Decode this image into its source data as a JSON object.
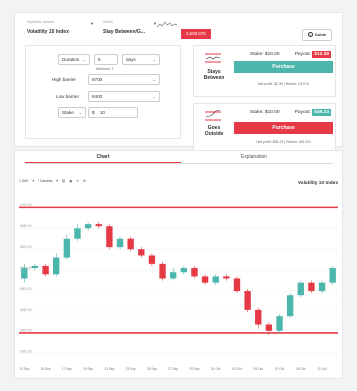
{
  "header": {
    "market_label": "Synthetic Indices",
    "market_value": "Volatility 10 Index",
    "type_label": "Out/In",
    "type_value": "Stay Between/G...",
    "price": "6,593.075",
    "guide_label": "Guide"
  },
  "params": {
    "duration_label": "Duration",
    "duration_value": "5",
    "duration_unit": "days",
    "duration_hint": "Minimum: 1",
    "high_label": "High barrier",
    "high_value": "6700",
    "low_label": "Low barrier",
    "low_value": "6400",
    "stake_label": "Stake",
    "currency": "$",
    "stake_value": "10"
  },
  "contracts": [
    {
      "name": "Stays Between",
      "stake": "Stake: $10.00",
      "payout_label": "Payout:",
      "payout_value": "$12.39",
      "button": "Purchase",
      "net": "Net profit: $2.39 | Return: 23.9 %",
      "accent": "#e63946",
      "button_color": "#4db6ac"
    },
    {
      "name": "Goes Outside",
      "stake": "Stake: $10.00",
      "payout_label": "Payout:",
      "payout_value": "$46.23",
      "button": "Purchase",
      "net": "Net profit: $36.23 | Return: 362.3%",
      "accent": "#4db6ac",
      "button_color": "#e63946"
    }
  ],
  "tabs": {
    "chart": "Chart",
    "explanation": "Explanation"
  },
  "toolbar": {
    "interval": "1 DAY",
    "style": "Candles",
    "icons": [
      "bar-chart-icon",
      "eye-icon",
      "pencil-icon",
      "settings-icon"
    ]
  },
  "chart_title": "Volatility 10 Index",
  "chart_data": {
    "type": "candlestick",
    "y_ticks": [
      "6700.00",
      "6650.00",
      "6600.00",
      "6550.00",
      "6500.00",
      "6450.00",
      "6400.00",
      "6350.00"
    ],
    "x_ticks": [
      "13 Sep",
      "14 Sep",
      "15 Sep",
      "16 Sep",
      "17 Sep",
      "18 Sep",
      "19 Sep",
      "20 Sep",
      "21 Sep",
      "22 Sep",
      "23 Sep",
      "24 Sep",
      "25 Sep",
      "26 Sep",
      "27 Sep",
      "28 Sep",
      "29 Sep",
      "30 Sep",
      "01 Oct",
      "02 Oct",
      "03 Oct",
      "04 Oct",
      "05 Oct",
      "06 Oct",
      "07 Oct",
      "08 Oct",
      "09 Oct",
      "10 Oct",
      "11 Oct",
      "12 Oct"
    ],
    "ylim": [
      6340,
      6720
    ],
    "barriers": [
      6700,
      6400
    ],
    "candles": [
      {
        "o": 6530,
        "c": 6555,
        "h": 6565,
        "l": 6520
      },
      {
        "o": 6555,
        "c": 6560,
        "h": 6565,
        "l": 6550
      },
      {
        "o": 6560,
        "c": 6540,
        "h": 6565,
        "l": 6535
      },
      {
        "o": 6540,
        "c": 6580,
        "h": 6590,
        "l": 6535
      },
      {
        "o": 6580,
        "c": 6625,
        "h": 6635,
        "l": 6575
      },
      {
        "o": 6625,
        "c": 6650,
        "h": 6660,
        "l": 6620
      },
      {
        "o": 6650,
        "c": 6660,
        "h": 6665,
        "l": 6645
      },
      {
        "o": 6660,
        "c": 6655,
        "h": 6665,
        "l": 6650
      },
      {
        "o": 6655,
        "c": 6605,
        "h": 6660,
        "l": 6600
      },
      {
        "o": 6605,
        "c": 6625,
        "h": 6630,
        "l": 6600
      },
      {
        "o": 6625,
        "c": 6600,
        "h": 6630,
        "l": 6595
      },
      {
        "o": 6600,
        "c": 6585,
        "h": 6605,
        "l": 6580
      },
      {
        "o": 6585,
        "c": 6565,
        "h": 6590,
        "l": 6560
      },
      {
        "o": 6565,
        "c": 6530,
        "h": 6570,
        "l": 6525
      },
      {
        "o": 6530,
        "c": 6545,
        "h": 6555,
        "l": 6525
      },
      {
        "o": 6545,
        "c": 6555,
        "h": 6560,
        "l": 6540
      },
      {
        "o": 6555,
        "c": 6535,
        "h": 6560,
        "l": 6530
      },
      {
        "o": 6535,
        "c": 6520,
        "h": 6540,
        "l": 6515
      },
      {
        "o": 6520,
        "c": 6535,
        "h": 6540,
        "l": 6515
      },
      {
        "o": 6535,
        "c": 6530,
        "h": 6540,
        "l": 6525
      },
      {
        "o": 6530,
        "c": 6500,
        "h": 6535,
        "l": 6495
      },
      {
        "o": 6500,
        "c": 6455,
        "h": 6505,
        "l": 6450
      },
      {
        "o": 6455,
        "c": 6420,
        "h": 6460,
        "l": 6410
      },
      {
        "o": 6420,
        "c": 6405,
        "h": 6425,
        "l": 6395
      },
      {
        "o": 6405,
        "c": 6440,
        "h": 6445,
        "l": 6398
      },
      {
        "o": 6440,
        "c": 6490,
        "h": 6495,
        "l": 6435
      },
      {
        "o": 6490,
        "c": 6520,
        "h": 6525,
        "l": 6485
      },
      {
        "o": 6520,
        "c": 6500,
        "h": 6525,
        "l": 6495
      },
      {
        "o": 6500,
        "c": 6520,
        "h": 6525,
        "l": 6495
      },
      {
        "o": 6520,
        "c": 6555,
        "h": 6560,
        "l": 6515
      }
    ]
  }
}
